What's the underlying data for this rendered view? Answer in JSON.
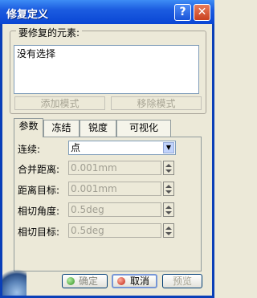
{
  "window": {
    "title": "修复定义"
  },
  "group": {
    "label": "要修复的元素:",
    "list_items": [
      "没有选择"
    ],
    "add_button": "添加模式",
    "remove_button": "移除模式"
  },
  "tabs": [
    "参数",
    "冻结",
    "锐度",
    "可视化"
  ],
  "active_tab": "参数",
  "params": {
    "continuity": {
      "label": "连续:",
      "value": "点"
    },
    "merge_distance": {
      "label": "合并距离:",
      "value": "0.001mm"
    },
    "distance_target": {
      "label": "距离目标:",
      "value": "0.001mm"
    },
    "tangent_angle": {
      "label": "相切角度:",
      "value": "0.5deg"
    },
    "tangent_target": {
      "label": "相切目标:",
      "value": "0.5deg"
    }
  },
  "footer": {
    "ok": "确定",
    "cancel": "取消",
    "preview": "预览"
  },
  "icons": [
    "help-icon",
    "close-icon",
    "dropdown-arrow-icon",
    "spinner-icon",
    "ok-icon",
    "cancel-icon",
    "app-logo-icon"
  ],
  "colors": {
    "titlebar": "#0a46d4",
    "dialog_bg": "#ece9d8",
    "ok_dot": "#2f8f21",
    "cancel_dot": "#c01c0c"
  }
}
